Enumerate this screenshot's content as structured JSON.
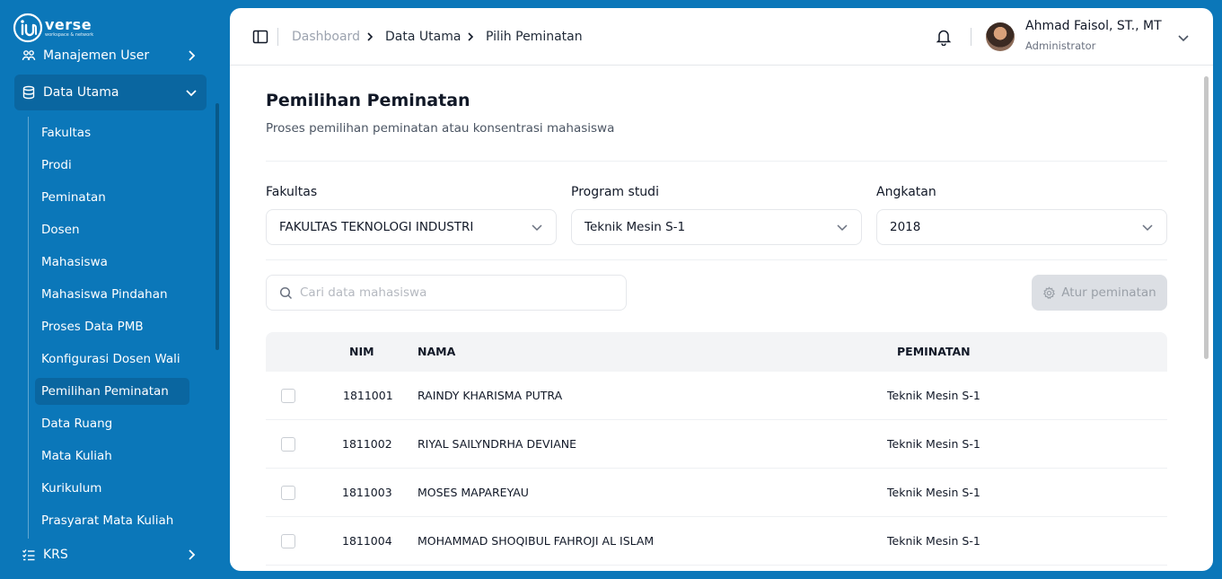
{
  "brand": {
    "word": "verse",
    "tagline": "workspace & network"
  },
  "sidebar": {
    "groups": [
      {
        "label": "Manajemen User"
      },
      {
        "label": "Data Utama"
      },
      {
        "label": "KRS"
      }
    ],
    "submenu": [
      {
        "label": "Fakultas"
      },
      {
        "label": "Prodi"
      },
      {
        "label": "Peminatan"
      },
      {
        "label": "Dosen"
      },
      {
        "label": "Mahasiswa"
      },
      {
        "label": "Mahasiswa Pindahan"
      },
      {
        "label": "Proses Data PMB"
      },
      {
        "label": "Konfigurasi Dosen Wali"
      },
      {
        "label": "Pemilihan Peminatan"
      },
      {
        "label": "Data Ruang"
      },
      {
        "label": "Mata Kuliah"
      },
      {
        "label": "Kurikulum"
      },
      {
        "label": "Prasyarat Mata Kuliah"
      }
    ],
    "active_item": "Pemilihan Peminatan"
  },
  "breadcrumb": [
    "Dashboard",
    "Data Utama",
    "Pilih Peminatan"
  ],
  "user": {
    "name": "Ahmad Faisol, ST., MT",
    "role": "Administrator"
  },
  "page": {
    "title": "Pemilihan Peminatan",
    "subtitle": "Proses pemilihan peminatan atau konsentrasi mahasiswa"
  },
  "filters": {
    "fakultas": {
      "label": "Fakultas",
      "value": "FAKULTAS TEKNOLOGI INDUSTRI"
    },
    "prodi": {
      "label": "Program studi",
      "value": "Teknik Mesin S-1"
    },
    "angkatan": {
      "label": "Angkatan",
      "value": "2018"
    }
  },
  "search": {
    "placeholder": "Cari data mahasiswa",
    "value": ""
  },
  "atur_button": {
    "label": "Atur peminatan",
    "enabled": false
  },
  "table": {
    "columns": [
      "NIM",
      "NAMA",
      "PEMINATAN"
    ],
    "rows": [
      {
        "nim": "1811001",
        "nama": "RAINDY KHARISMA PUTRA",
        "peminatan": "Teknik Mesin S-1"
      },
      {
        "nim": "1811002",
        "nama": "RIYAL SAILYNDRHA DEVIANE",
        "peminatan": "Teknik Mesin S-1"
      },
      {
        "nim": "1811003",
        "nama": "MOSES MAPAREYAU",
        "peminatan": "Teknik Mesin S-1"
      },
      {
        "nim": "1811004",
        "nama": "MOHAMMAD SHOQIBUL FAHROJI AL ISLAM",
        "peminatan": "Teknik Mesin S-1"
      }
    ]
  },
  "colors": {
    "sidebar_bg": "#0b77b9",
    "sidebar_active": "#0a66a0",
    "button_disabled": "#dcdfe4"
  }
}
